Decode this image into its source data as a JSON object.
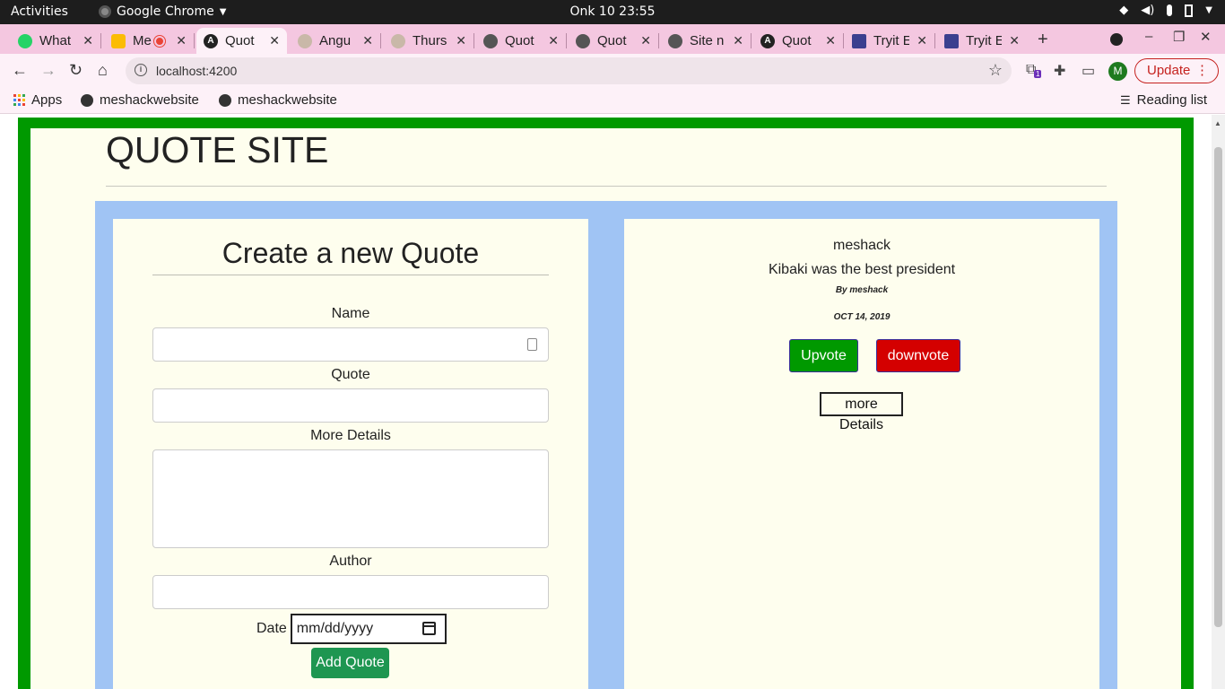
{
  "os": {
    "activities": "Activities",
    "app_name": "Google Chrome",
    "clock": "Onk 10  23:55"
  },
  "browser": {
    "tabs": [
      {
        "label": "What",
        "color": "#25d366"
      },
      {
        "label": "Me",
        "color": "#ea4335"
      },
      {
        "label": "Quot",
        "color": "#222222",
        "active": true
      },
      {
        "label": "Angu",
        "color": "#b0a090"
      },
      {
        "label": "Thurs",
        "color": "#b0a090"
      },
      {
        "label": "Quot",
        "color": "#444444"
      },
      {
        "label": "Quot",
        "color": "#444444"
      },
      {
        "label": "Site n",
        "color": "#444444"
      },
      {
        "label": "Quot",
        "color": "#222222"
      },
      {
        "label": "Tryit E",
        "color": "#3b3f8f"
      },
      {
        "label": "Tryit E",
        "color": "#3b3f8f"
      }
    ],
    "url": "localhost:4200",
    "update_label": "Update",
    "avatar_letter": "M",
    "extension_badge": "1",
    "bookmarks": {
      "apps": "Apps",
      "items": [
        "meshackwebsite",
        "meshackwebsite"
      ],
      "reading_list": "Reading list"
    }
  },
  "page": {
    "site_title": "QUOTE SITE",
    "form": {
      "heading": "Create a new Quote",
      "name_label": "Name",
      "quote_label": "Quote",
      "details_label": "More Details",
      "author_label": "Author",
      "date_label": "Date",
      "date_placeholder": "mm/dd/yyyy",
      "submit_label": "Add Quote"
    },
    "quote": {
      "name": "meshack",
      "text": "Kibaki was the best president",
      "by": "By meshack",
      "date": "OCT 14, 2019",
      "upvote_label": "Upvote",
      "downvote_label": "downvote",
      "details_label": "more Details"
    }
  },
  "colors": {
    "frame_green": "#009900",
    "panel_blue": "#a0c4f4",
    "card_cream": "#fefeee",
    "add_button": "#1e9651",
    "downvote": "#d40000"
  }
}
